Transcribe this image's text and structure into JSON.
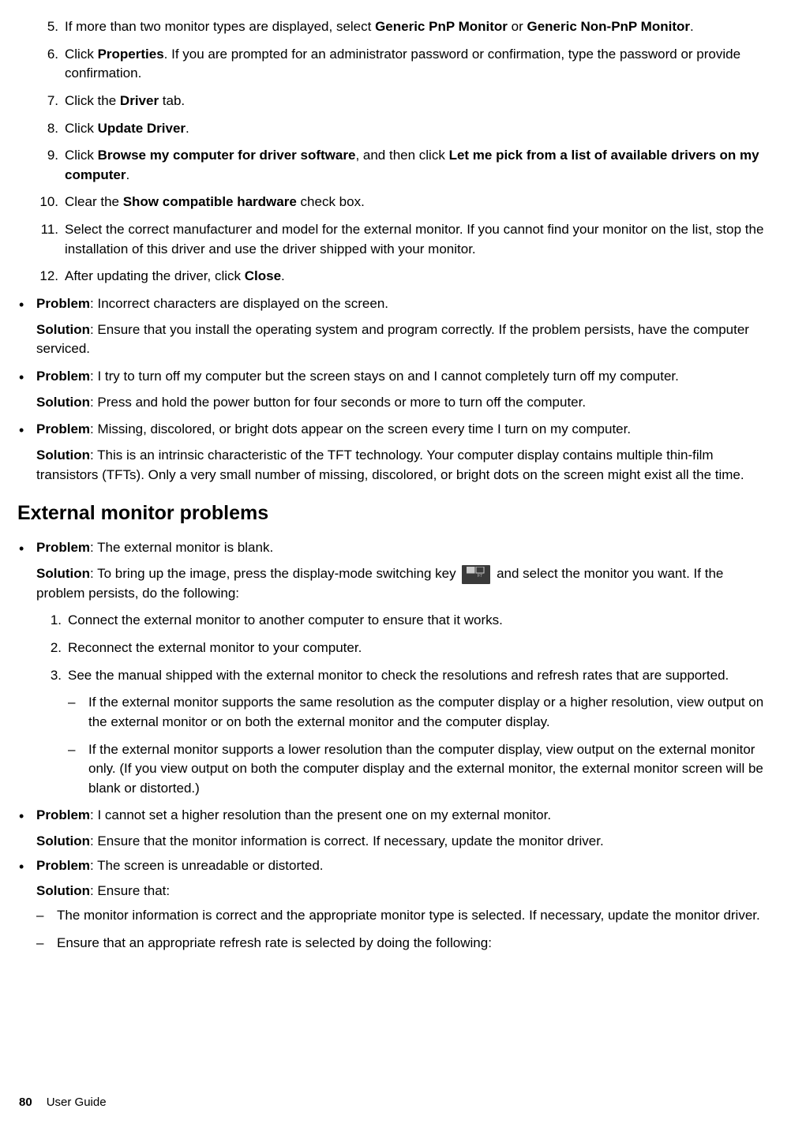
{
  "steps_top": [
    {
      "n": "5.",
      "pre": "If more than two monitor types are displayed, select ",
      "bold1": "Generic PnP Monitor",
      "mid": " or ",
      "bold2": "Generic Non-PnP Monitor",
      "post": "."
    },
    {
      "n": "6.",
      "pre": "Click ",
      "bold1": "Properties",
      "post": ". If you are prompted for an administrator password or confirmation, type the password or provide confirmation."
    },
    {
      "n": "7.",
      "pre": "Click the ",
      "bold1": "Driver",
      "post": " tab."
    },
    {
      "n": "8.",
      "pre": "Click ",
      "bold1": "Update Driver",
      "post": "."
    },
    {
      "n": "9.",
      "pre": "Click ",
      "bold1": "Browse my computer for driver software",
      "mid": ", and then click ",
      "bold2": "Let me pick from a list of available drivers on my computer",
      "post": "."
    },
    {
      "n": "10.",
      "pre": "Clear the ",
      "bold1": "Show compatible hardware",
      "post": " check box."
    },
    {
      "n": "11.",
      "plain": "Select the correct manufacturer and model for the external monitor. If you cannot find your monitor on the list, stop the installation of this driver and use the driver shipped with your monitor."
    },
    {
      "n": "12.",
      "pre": "After updating the driver, click ",
      "bold1": "Close",
      "post": "."
    }
  ],
  "prob_a": {
    "label": "Problem",
    "text": ": Incorrect characters are displayed on the screen."
  },
  "sol_a": {
    "label": "Solution",
    "text": ": Ensure that you install the operating system and program correctly. If the problem persists, have the computer serviced."
  },
  "prob_b": {
    "label": "Problem",
    "text": ": I try to turn off my computer but the screen stays on and I cannot completely turn off my computer."
  },
  "sol_b": {
    "label": "Solution",
    "text": ": Press and hold the power button for four seconds or more to turn off the computer."
  },
  "prob_c": {
    "label": "Problem",
    "text": ": Missing, discolored, or bright dots appear on the screen every time I turn on my computer."
  },
  "sol_c": {
    "label": "Solution",
    "text": ": This is an intrinsic characteristic of the TFT technology. Your computer display contains multiple thin-film transistors (TFTs). Only a very small number of missing, discolored, or bright dots on the screen might exist all the time."
  },
  "section_heading": "External monitor problems",
  "prob_d": {
    "label": "Problem",
    "text": ": The external monitor is blank."
  },
  "sol_d": {
    "label": "Solution",
    "pre": ": To bring up the image, press the display-mode switching key ",
    "post": " and select the monitor you want. If the problem persists, do the following:"
  },
  "key_label": "F7",
  "ext_steps": [
    {
      "n": "1.",
      "text": "Connect the external monitor to another computer to ensure that it works."
    },
    {
      "n": "2.",
      "text": "Reconnect the external monitor to your computer."
    },
    {
      "n": "3.",
      "text": "See the manual shipped with the external monitor to check the resolutions and refresh rates that are supported."
    }
  ],
  "ext_dashes": [
    "If the external monitor supports the same resolution as the computer display or a higher resolution, view output on the external monitor or on both the external monitor and the computer display.",
    "If the external monitor supports a lower resolution than the computer display, view output on the external monitor only. (If you view output on both the computer display and the external monitor, the external monitor screen will be blank or distorted.)"
  ],
  "prob_e": {
    "label": "Problem",
    "text": ": I cannot set a higher resolution than the present one on my external monitor."
  },
  "sol_e": {
    "label": "Solution",
    "text": ": Ensure that the monitor information is correct. If necessary, update the monitor driver."
  },
  "prob_f": {
    "label": "Problem",
    "text": ": The screen is unreadable or distorted."
  },
  "sol_f": {
    "label": "Solution",
    "text": ": Ensure that:"
  },
  "f_dashes": [
    "The monitor information is correct and the appropriate monitor type is selected. If necessary, update the monitor driver.",
    "Ensure that an appropriate refresh rate is selected by doing the following:"
  ],
  "footer": {
    "page": "80",
    "title": "User Guide"
  }
}
